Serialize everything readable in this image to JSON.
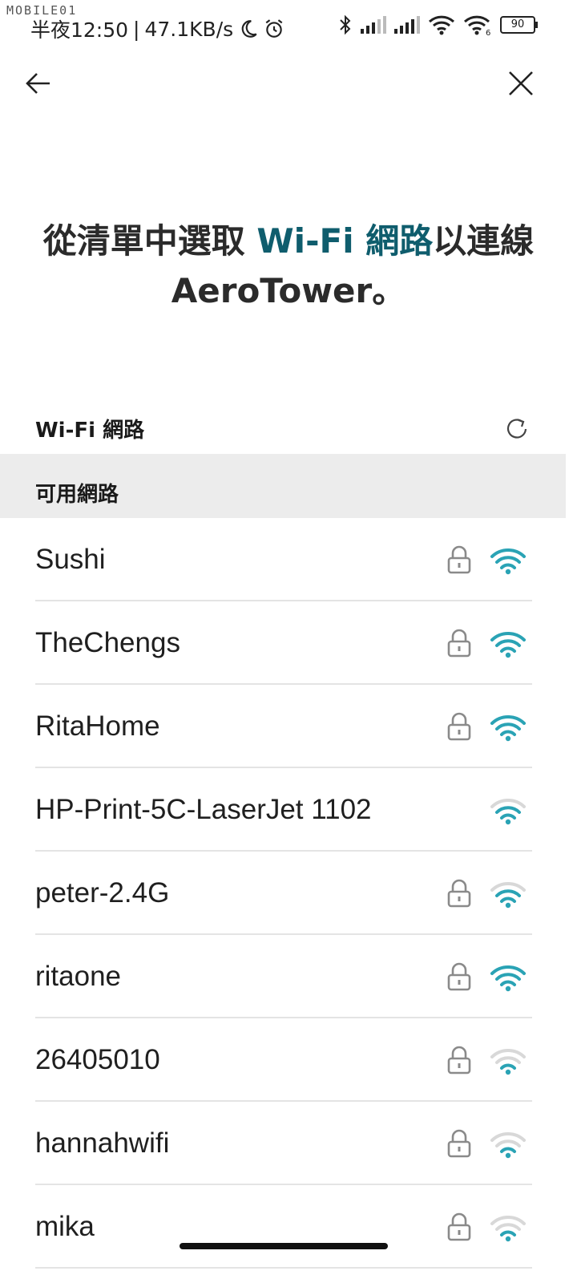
{
  "status_bar": {
    "watermark": "MOBILE01",
    "time": "半夜12:50",
    "separator": "|",
    "speed": "47.1KB/s",
    "battery": "90",
    "icons": [
      "moon-icon",
      "alarm-icon",
      "bluetooth-icon",
      "signal-icon",
      "signal-icon",
      "wifi-icon",
      "wifi-6-icon",
      "battery-icon"
    ]
  },
  "nav": {
    "back_icon": "arrow-left-icon",
    "close_icon": "close-icon"
  },
  "heading": {
    "part1": "從清單中選取 ",
    "accent": "Wi-Fi 網路",
    "part2": "以連線 AeroTower。",
    "accent_color": "#0f5d6d"
  },
  "section": {
    "title": "Wi-Fi 網路",
    "refresh_icon": "refresh-icon",
    "available_label": "可用網路"
  },
  "colors": {
    "wifi_strong": "#2aa3b5",
    "wifi_weak": "#d8d8d8",
    "lock": "#8a8a8a"
  },
  "networks": [
    {
      "name": "Sushi",
      "locked": true,
      "strength": 4
    },
    {
      "name": "TheChengs",
      "locked": true,
      "strength": 4
    },
    {
      "name": "RitaHome",
      "locked": true,
      "strength": 4
    },
    {
      "name": "HP-Print-5C-LaserJet 1102",
      "locked": false,
      "strength": 3
    },
    {
      "name": "peter-2.4G",
      "locked": true,
      "strength": 3
    },
    {
      "name": "ritaone",
      "locked": true,
      "strength": 4
    },
    {
      "name": "26405010",
      "locked": true,
      "strength": 2
    },
    {
      "name": "hannahwifi",
      "locked": true,
      "strength": 2
    },
    {
      "name": "mika",
      "locked": true,
      "strength": 2
    }
  ]
}
